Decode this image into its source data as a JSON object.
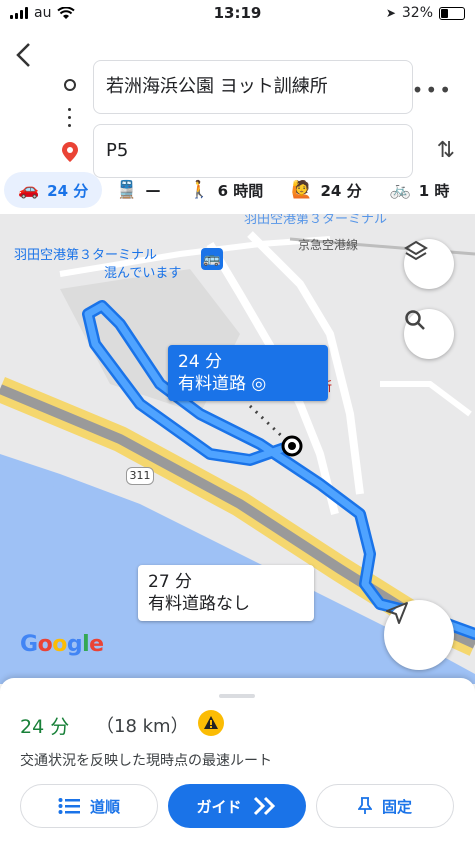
{
  "status_bar": {
    "carrier": "au",
    "time": "13:19",
    "battery": "32%"
  },
  "header": {
    "origin": "若洲海浜公園 ヨット訓練所",
    "destination": "P5"
  },
  "modes": [
    {
      "icon": "car-icon",
      "label": "24 分",
      "active": true
    },
    {
      "icon": "train-icon",
      "label": "—"
    },
    {
      "icon": "walk-icon",
      "label": "6 時間"
    },
    {
      "icon": "rideshare-icon",
      "label": "24 分"
    },
    {
      "icon": "bike-icon",
      "label": "1 時"
    }
  ],
  "map": {
    "labels": {
      "terminal": "羽田空港第３ターミナル",
      "crowded": "混んでいます",
      "railway": "京急空港線",
      "top_cut": "羽田空港第３ターミナル",
      "parking_partial": "場所",
      "road_number": "311"
    },
    "primary_route": {
      "time": "24 分",
      "note": "有料道路"
    },
    "alt_route": {
      "time": "27 分",
      "note": "有料道路なし"
    },
    "google": "Google",
    "route_color": "#4285f4"
  },
  "sheet": {
    "eta": "24 分",
    "distance": "（18 km）",
    "description": "交通状況を反映した現時点の最速ルート",
    "buttons": {
      "steps": "道順",
      "guide": "ガイド",
      "pin": "固定"
    }
  }
}
